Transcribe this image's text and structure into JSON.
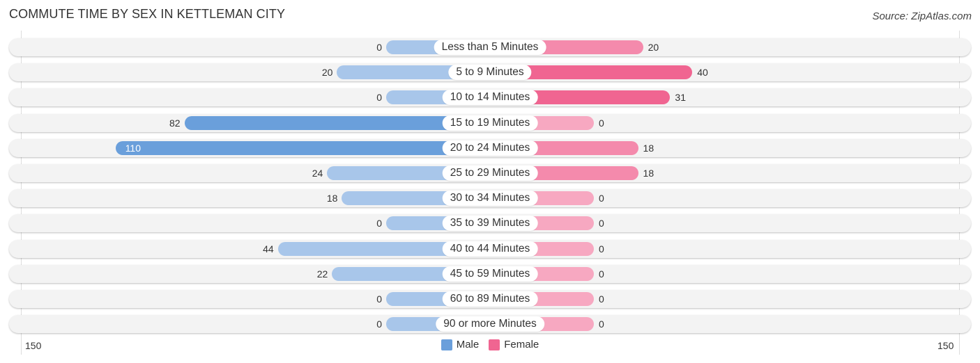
{
  "header": {
    "title": "COMMUTE TIME BY SEX IN KETTLEMAN CITY",
    "source": "Source: ZipAtlas.com"
  },
  "colors": {
    "male_dark": "#6a9fdb",
    "male_light": "#a8c6ea",
    "female_dark": "#f06591",
    "female_light": "#f7a8c1",
    "row_bg": "#f3f3f3"
  },
  "chart_data": {
    "type": "bar",
    "orientation": "horizontal-diverging",
    "title": "COMMUTE TIME BY SEX IN KETTLEMAN CITY",
    "categories": [
      "Less than 5 Minutes",
      "5 to 9 Minutes",
      "10 to 14 Minutes",
      "15 to 19 Minutes",
      "20 to 24 Minutes",
      "25 to 29 Minutes",
      "30 to 34 Minutes",
      "35 to 39 Minutes",
      "40 to 44 Minutes",
      "45 to 59 Minutes",
      "60 to 89 Minutes",
      "90 or more Minutes"
    ],
    "series": [
      {
        "name": "Male",
        "side": "left",
        "values": [
          0,
          20,
          0,
          82,
          110,
          24,
          18,
          0,
          44,
          22,
          0,
          0
        ]
      },
      {
        "name": "Female",
        "side": "right",
        "values": [
          20,
          40,
          31,
          0,
          18,
          18,
          0,
          0,
          0,
          0,
          0,
          0
        ]
      }
    ],
    "axis": {
      "left_label": "150",
      "right_label": "150",
      "max": 150
    },
    "legend": {
      "position": "bottom-center",
      "entries": [
        "Male",
        "Female"
      ]
    }
  }
}
